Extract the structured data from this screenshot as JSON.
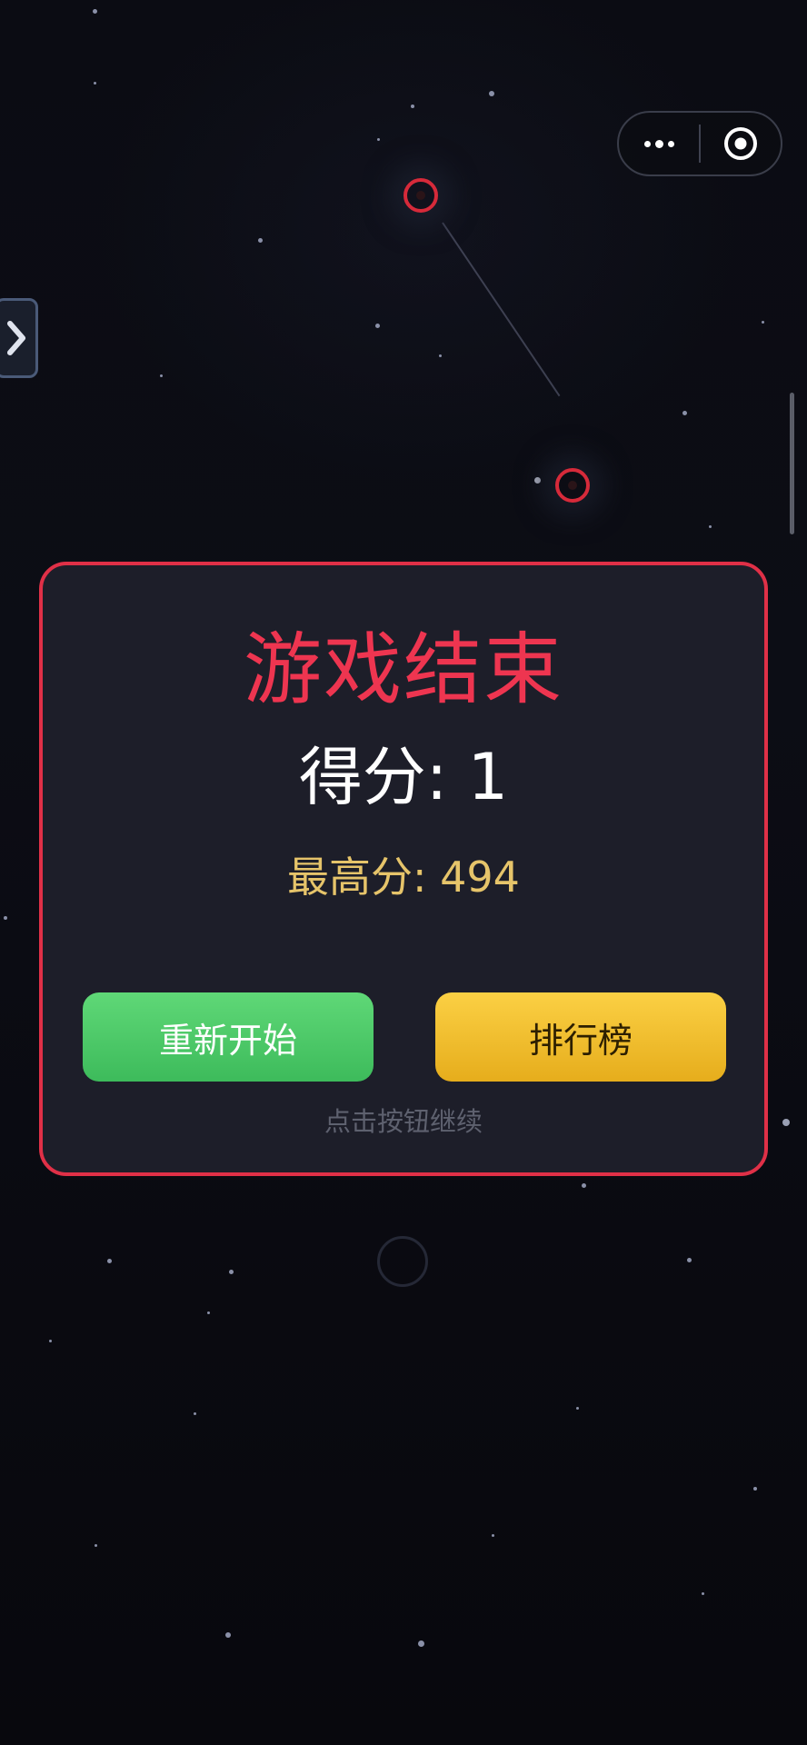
{
  "game_over": {
    "title": "游戏结束",
    "score_label": "得分",
    "score_value": "1",
    "score_text": "得分: 1",
    "best_label": "最高分",
    "best_value": "494",
    "best_text": "最高分: 494",
    "restart_button": "重新开始",
    "leaderboard_button": "排行榜",
    "hint": "点击按钮继续"
  },
  "capsule": {
    "more_icon": "more-dots-icon",
    "close_icon": "target-circle-icon"
  },
  "side_tab": {
    "icon": "chevron-right-icon",
    "glyph": "❯"
  },
  "colors": {
    "accent_red": "#e03047",
    "title_red": "#ee3550",
    "best_gold": "#e6c46a",
    "restart_green": "#4cc966",
    "rank_yellow": "#f5bf2e",
    "panel_bg": "#1d1e29",
    "background": "#0a0a10"
  }
}
